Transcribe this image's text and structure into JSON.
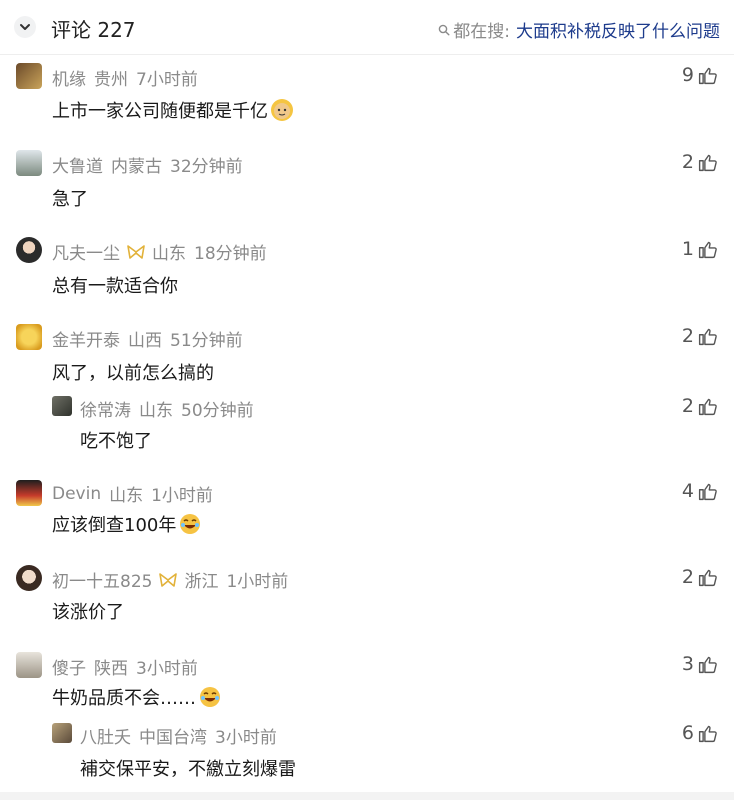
{
  "header": {
    "title": "评论 227",
    "search_prefix": "都在搜:",
    "search_link": "大面积补税反映了什么问题"
  },
  "comments": [
    {
      "user": "机缘",
      "loc": "贵州",
      "time": "7小时前",
      "text": "上市一家公司随便都是千亿",
      "likes": "9"
    },
    {
      "user": "大鲁道",
      "loc": "内蒙古",
      "time": "32分钟前",
      "text": "急了",
      "likes": "2"
    },
    {
      "user": "凡夫一尘",
      "loc": "山东",
      "time": "18分钟前",
      "text": "总有一款适合你",
      "likes": "1"
    },
    {
      "user": "金羊开泰",
      "loc": "山西",
      "time": "51分钟前",
      "text": "风了，以前怎么搞的",
      "likes": "2"
    },
    {
      "user": "徐常涛",
      "loc": "山东",
      "time": "50分钟前",
      "text": "吃不饱了",
      "likes": "2"
    },
    {
      "user": "Devin",
      "loc": "山东",
      "time": "1小时前",
      "text": "应该倒查100年",
      "likes": "4"
    },
    {
      "user": "初一十五825",
      "loc": "浙江",
      "time": "1小时前",
      "text": "该涨价了",
      "likes": "2"
    },
    {
      "user": "傻子",
      "loc": "陕西",
      "time": "3小时前",
      "text": "牛奶品质不会……",
      "likes": "3"
    },
    {
      "user": "八肚夭",
      "loc": "中国台湾",
      "time": "3小时前",
      "text": "補交保平安，不繳立刻爆雷",
      "likes": "6"
    }
  ],
  "colors": {
    "accent_link": "#1d3b8c",
    "meta_gray": "#8a8a8a",
    "badge_gold": "#e2b23a"
  }
}
